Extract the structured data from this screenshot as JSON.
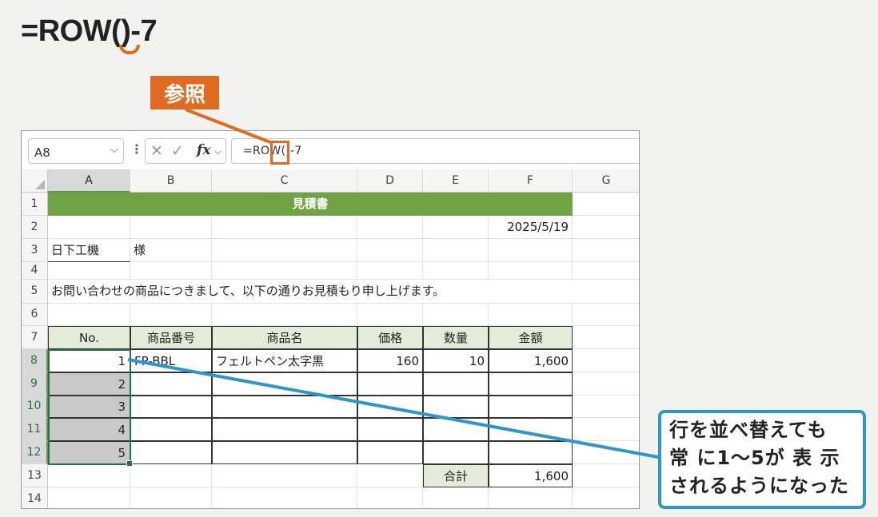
{
  "heading": {
    "formula": "=ROW()-7"
  },
  "badge": {
    "label": "参照"
  },
  "callout": {
    "lines": [
      "行を並べ替えても",
      "常 に1～5が 表 示",
      "されるようになった"
    ]
  },
  "colors": {
    "accent_orange": "#e06a1f",
    "callout_blue": "#2e95cd",
    "title_green": "#70a343",
    "header_green": "#e3ecd9",
    "selected_grey": "#c9c9c9"
  },
  "excel": {
    "name_box": "A8",
    "formula": "=ROW()-7",
    "icons": [
      "cancel-icon",
      "enter-icon",
      "fx-icon"
    ],
    "columns": [
      "A",
      "B",
      "C",
      "D",
      "E",
      "F",
      "G"
    ],
    "rows": [
      "1",
      "2",
      "3",
      "4",
      "5",
      "6",
      "7",
      "8",
      "9",
      "10",
      "11",
      "12",
      "13",
      "14"
    ],
    "title": "見積書",
    "date": "2025/5/19",
    "client": "日下工機",
    "honorific": "様",
    "message": "お問い合わせの商品につきまして、以下の通りお見積もり申し上げます。",
    "table_headers": [
      "No.",
      "商品番号",
      "商品名",
      "価格",
      "数量",
      "金額"
    ],
    "table_rows": [
      [
        "1",
        "FP-BBL",
        "フェルトペン太字黒",
        "160",
        "10",
        "1,600"
      ],
      [
        "2",
        "",
        "",
        "",
        "",
        ""
      ],
      [
        "3",
        "",
        "",
        "",
        "",
        ""
      ],
      [
        "4",
        "",
        "",
        "",
        "",
        ""
      ],
      [
        "5",
        "",
        "",
        "",
        "",
        ""
      ]
    ],
    "total_label": "合計",
    "total_value": "1,600"
  }
}
